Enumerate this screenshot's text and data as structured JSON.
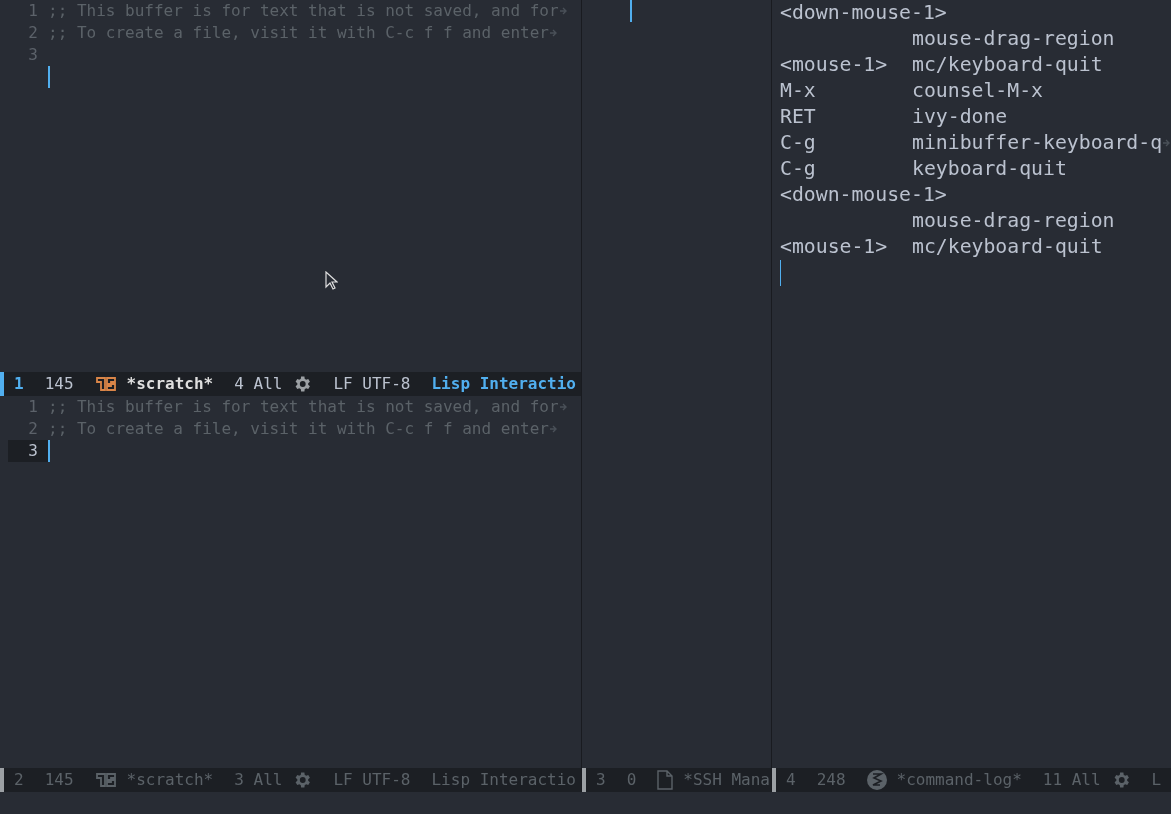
{
  "left_top_window": {
    "lines": [
      {
        "number": "1",
        "current": false,
        "text": ";; This buffer is for text that is not saved, and for",
        "continued": true
      },
      {
        "number": "2",
        "current": false,
        "text": ";; To create a file, visit it with C-c f f and enter",
        "continued": true
      },
      {
        "number": "3",
        "current": false
      }
    ],
    "cursor_line": true
  },
  "left_top_modeline": {
    "active": true,
    "segments": [
      {
        "kind": "window_number",
        "text": "1"
      },
      {
        "kind": "text",
        "text": "145"
      },
      {
        "kind": "lisp_icon"
      },
      {
        "kind": "buffer",
        "text": "*scratch*"
      },
      {
        "kind": "text",
        "text": "4 All"
      },
      {
        "kind": "gear_icon"
      },
      {
        "kind": "text",
        "text": "LF UTF-8"
      },
      {
        "kind": "mode",
        "text": "Lisp Interactio"
      }
    ]
  },
  "left_bottom_window": {
    "lines": [
      {
        "number": "1",
        "current": false,
        "text": ";; This buffer is for text that is not saved, and for",
        "continued": true
      },
      {
        "number": "2",
        "current": false,
        "text": ";; To create a file, visit it with C-c f f and enter",
        "continued": true
      },
      {
        "number": "3",
        "current": true
      }
    ]
  },
  "left_bottom_modeline": {
    "active": false,
    "segments": [
      {
        "kind": "window_number",
        "text": "2"
      },
      {
        "kind": "text",
        "text": "145"
      },
      {
        "kind": "lisp_icon"
      },
      {
        "kind": "buffer",
        "text": "*scratch*"
      },
      {
        "kind": "text",
        "text": "3 All"
      },
      {
        "kind": "gear_icon"
      },
      {
        "kind": "text",
        "text": "LF UTF-8"
      },
      {
        "kind": "mode",
        "text": "Lisp Interactio"
      }
    ]
  },
  "middle_window": {
    "cursor_line": true
  },
  "middle_modeline": {
    "active": false,
    "segments": [
      {
        "kind": "window_number",
        "text": "3"
      },
      {
        "kind": "text",
        "text": "0"
      },
      {
        "kind": "file_icon"
      },
      {
        "kind": "buffer",
        "text": "*SSH Mana"
      }
    ]
  },
  "command_log": {
    "rows": [
      {
        "key": "<down-mouse-1>"
      },
      {
        "command": "mouse-drag-region"
      },
      {
        "key": "<mouse-1>",
        "command": "mc/keyboard-quit"
      },
      {
        "key": "M-x",
        "command": "counsel-M-x"
      },
      {
        "key": "RET",
        "command": "ivy-done"
      },
      {
        "key": "C-g",
        "command": "minibuffer-keyboard-q",
        "continued": true
      },
      {
        "key": "C-g",
        "command": "keyboard-quit"
      },
      {
        "key": "<down-mouse-1>"
      },
      {
        "command": "mouse-drag-region"
      },
      {
        "key": "<mouse-1>",
        "command": "mc/keyboard-quit"
      }
    ]
  },
  "right_modeline": {
    "active": false,
    "segments": [
      {
        "kind": "window_number",
        "text": "4"
      },
      {
        "kind": "text",
        "text": "248"
      },
      {
        "kind": "emacs_icon"
      },
      {
        "kind": "buffer",
        "text": "*command-log*"
      },
      {
        "kind": "text",
        "text": "11 All"
      },
      {
        "kind": "gear_icon"
      },
      {
        "kind": "text",
        "text": "L"
      }
    ]
  }
}
